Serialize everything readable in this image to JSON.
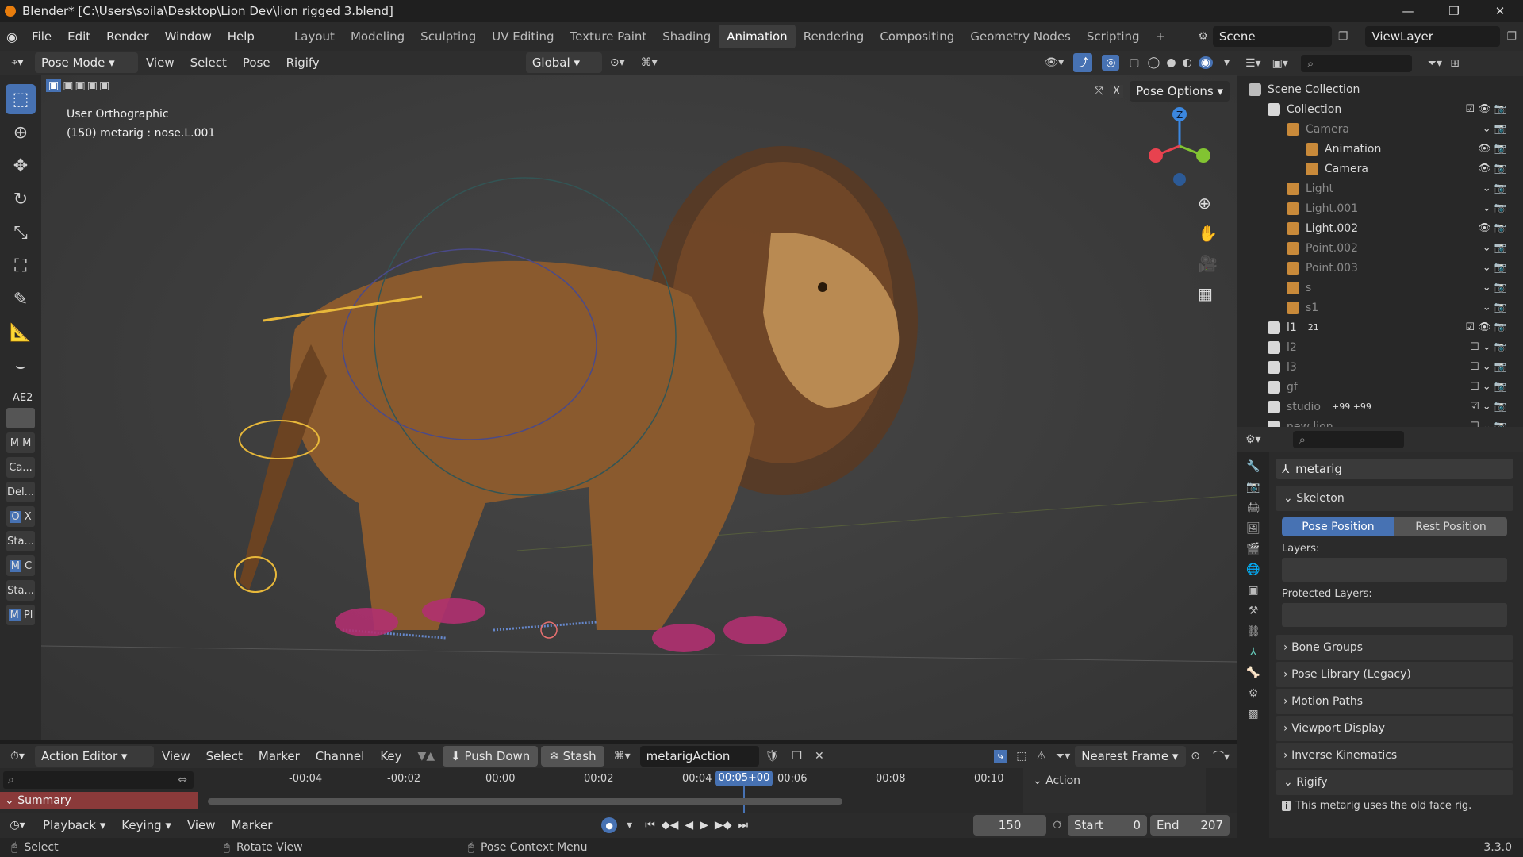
{
  "title_bar": {
    "text": "Blender* [C:\\Users\\soila\\Desktop\\Lion Dev\\lion rigged 3.blend]",
    "minimize": "—",
    "maximize": "❐",
    "close": "✕"
  },
  "menu": [
    "File",
    "Edit",
    "Render",
    "Window",
    "Help"
  ],
  "workspaces": [
    "Layout",
    "Modeling",
    "Sculpting",
    "UV Editing",
    "Texture Paint",
    "Shading",
    "Animation",
    "Rendering",
    "Compositing",
    "Geometry Nodes",
    "Scripting",
    "+"
  ],
  "active_workspace": "Animation",
  "scene": "Scene",
  "view_layer": "ViewLayer",
  "viewport_header": {
    "mode": "Pose Mode",
    "menus": [
      "View",
      "Select",
      "Pose",
      "Rigify"
    ],
    "transform_orientation": "Global",
    "pose_options": "Pose Options"
  },
  "viewport": {
    "view_name": "User Orthographic",
    "object_info": "(150) metarig : nose.L.001",
    "gizmo_axes": {
      "z": "Z",
      "x_color": "#e8424f",
      "y_color": "#82c432",
      "z_color": "#3b87e0"
    }
  },
  "tools": [
    "select-box",
    "cursor",
    "move",
    "rotate",
    "scale",
    "transform",
    "annotate",
    "measure",
    "bone-roll"
  ],
  "n_panel": {
    "title": "AE2",
    "buttons": [
      [
        "M",
        "M"
      ],
      [
        "Ca..."
      ],
      [
        "Del..."
      ],
      [
        "O",
        "X"
      ],
      [
        "Sta..."
      ],
      [
        "M",
        "C"
      ],
      [
        "Sta..."
      ],
      [
        "M",
        "Pl"
      ]
    ]
  },
  "outliner": {
    "search_placeholder": "",
    "rows": [
      {
        "label": "Scene Collection",
        "indent": 0,
        "muted": false
      },
      {
        "label": "Collection",
        "indent": 1,
        "muted": false,
        "checked": true
      },
      {
        "label": "Camera",
        "indent": 2,
        "muted": true
      },
      {
        "label": "Animation",
        "indent": 3,
        "muted": false
      },
      {
        "label": "Camera",
        "indent": 3,
        "muted": false
      },
      {
        "label": "Light",
        "indent": 2,
        "muted": true
      },
      {
        "label": "Light.001",
        "indent": 2,
        "muted": true
      },
      {
        "label": "Light.002",
        "indent": 2,
        "muted": false
      },
      {
        "label": "Point.002",
        "indent": 2,
        "muted": true
      },
      {
        "label": "Point.003",
        "indent": 2,
        "muted": true
      },
      {
        "label": "s",
        "indent": 2,
        "muted": true
      },
      {
        "label": "s1",
        "indent": 2,
        "muted": true
      },
      {
        "label": "l1",
        "indent": 1,
        "muted": false,
        "checked": true,
        "badge": "21"
      },
      {
        "label": "l2",
        "indent": 1,
        "muted": true
      },
      {
        "label": "l3",
        "indent": 1,
        "muted": true
      },
      {
        "label": "gf",
        "indent": 1,
        "muted": true
      },
      {
        "label": "studio",
        "indent": 1,
        "muted": true,
        "checked": true,
        "badge": "+99 +99"
      },
      {
        "label": "new lion",
        "indent": 1,
        "muted": true
      }
    ]
  },
  "properties": {
    "object_name": "metarig",
    "skeleton_label": "Skeleton",
    "pose_position": "Pose Position",
    "rest_position": "Rest Position",
    "layers_label": "Layers:",
    "protected_layers_label": "Protected Layers:",
    "sections": [
      "Bone Groups",
      "Pose Library (Legacy)",
      "Motion Paths",
      "Viewport Display",
      "Inverse Kinematics",
      "Rigify"
    ],
    "rigify_note": "This metarig uses the old face rig."
  },
  "action_editor": {
    "mode": "Action Editor",
    "menus": [
      "View",
      "Select",
      "Marker",
      "Channel",
      "Key"
    ],
    "push_down": "Push Down",
    "stash": "Stash",
    "action_name": "metarigAction",
    "snap": "Nearest Frame",
    "side_panel_title": "Action",
    "side_panel_value": "metarigAction",
    "summary": "Summary",
    "ruler_labels": [
      "-00:04",
      "-00:02",
      "00:00",
      "00:02",
      "00:04",
      "00:06",
      "00:08",
      "00:10"
    ],
    "current_time": "00:05+00"
  },
  "playback": {
    "menus": [
      "Playback",
      "Keying",
      "View",
      "Marker"
    ],
    "current_frame": "150",
    "start_label": "Start",
    "start": "0",
    "end_label": "End",
    "end": "207"
  },
  "status_bar": {
    "items": [
      "Select",
      "Rotate View",
      "Pose Context Menu"
    ],
    "version": "3.3.0"
  }
}
